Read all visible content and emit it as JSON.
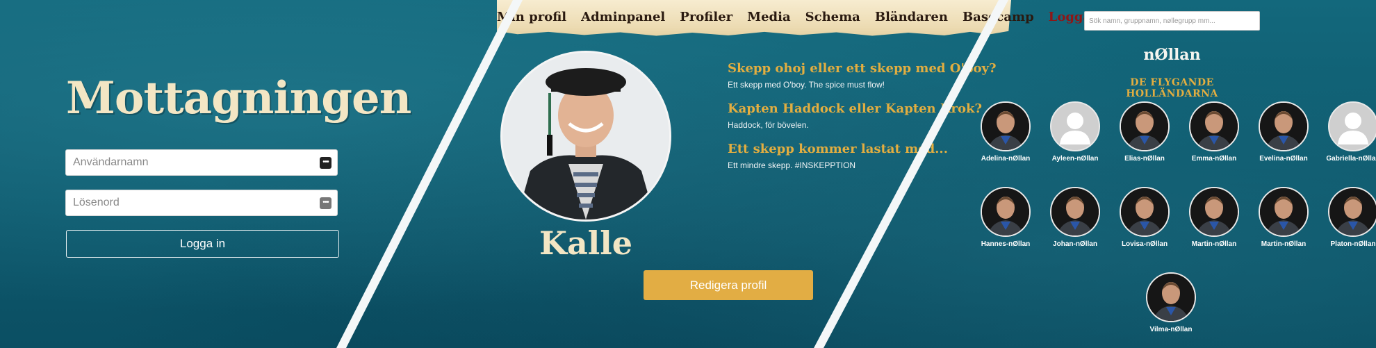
{
  "login": {
    "title": "Mottagningen",
    "username_placeholder": "Användarnamn",
    "password_placeholder": "Lösenord",
    "submit_label": "Logga in"
  },
  "nav": {
    "items": [
      {
        "label": "Min profil"
      },
      {
        "label": "Adminpanel"
      },
      {
        "label": "Profiler"
      },
      {
        "label": "Media"
      },
      {
        "label": "Schema"
      },
      {
        "label": "Bländaren"
      },
      {
        "label": "Basecamp"
      },
      {
        "label": "Logga ut"
      }
    ]
  },
  "profile": {
    "name": "Kalle",
    "questions": [
      {
        "q": "Skepp ohoj eller ett skepp med O'boy?",
        "a": "Ett skepp med O'boy. The spice must flow!"
      },
      {
        "q": "Kapten Haddock eller Kapten Krok?",
        "a": "Haddock, för bövelen."
      },
      {
        "q": "Ett skepp kommer lastat med...",
        "a": "Ett mindre skepp. #INSKEPPTION"
      }
    ],
    "edit_label": "Redigera profil"
  },
  "group": {
    "search_placeholder": "Sök namn, gruppnamn, nøllegrupp mm...",
    "title": "nØllan",
    "subtitle": "DE FLYGANDE HOLLÄNDARNA",
    "members": [
      {
        "name": "Adelina-nØllan",
        "photo": "photo"
      },
      {
        "name": "Ayleen-nØllan",
        "photo": "placeholder-avatar-icon"
      },
      {
        "name": "Elias-nØllan",
        "photo": "photo"
      },
      {
        "name": "Emma-nØllan",
        "photo": "photo"
      },
      {
        "name": "Evelina-nØllan",
        "photo": "photo"
      },
      {
        "name": "Gabriella-nØllan",
        "photo": "placeholder-avatar-icon"
      },
      {
        "name": "Hannes-nØllan",
        "photo": "photo"
      },
      {
        "name": "Johan-nØllan",
        "photo": "photo"
      },
      {
        "name": "Lovisa-nØllan",
        "photo": "photo"
      },
      {
        "name": "Martin-nØllan",
        "photo": "photo"
      },
      {
        "name": "Martin-nØllan",
        "photo": "photo"
      },
      {
        "name": "Platon-nØllan",
        "photo": "photo"
      },
      {
        "name": "Vilma-nØllan",
        "photo": "photo"
      }
    ]
  },
  "colors": {
    "background": "#0f5f73",
    "accent_gold": "#e3ae40",
    "title_cream": "#f3e6c4",
    "logout_red": "#8f1616"
  }
}
